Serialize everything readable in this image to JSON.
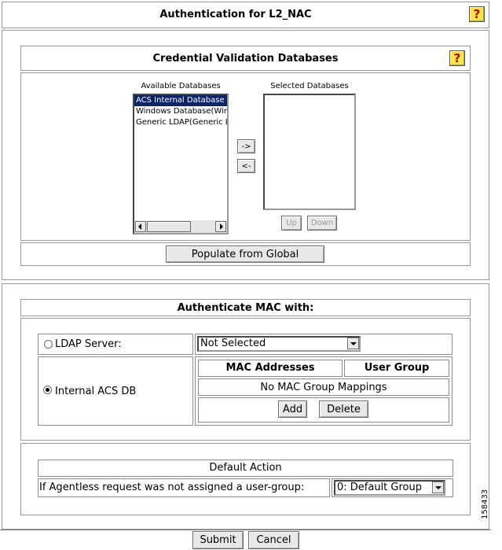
{
  "header": {
    "title": "Authentication for L2_NAC",
    "help_icon": "question-mark-icon"
  },
  "credential": {
    "title": "Credential Validation Databases",
    "available_label": "Available Databases",
    "selected_label": "Selected Databases",
    "available_items": [
      "ACS Internal Database",
      "Windows Database(Windo",
      "Generic LDAP(Generic LL"
    ],
    "selected_items": [],
    "move_right": "->",
    "move_left": "<-",
    "up": "Up",
    "down": "Down",
    "populate": "Populate from Global"
  },
  "mac": {
    "title": "Authenticate MAC with:",
    "ldap_label": "LDAP Server:",
    "ldap_value": "Not Selected",
    "internal_label": "Internal ACS DB",
    "selected_option": "Internal ACS DB",
    "col_mac": "MAC Addresses",
    "col_group": "User Group",
    "empty_text": "No MAC Group Mappings",
    "add": "Add",
    "delete": "Delete"
  },
  "default_action": {
    "title": "Default Action",
    "label": "If Agentless request was not assigned a user-group:",
    "value": "0: Default Group"
  },
  "footer": {
    "submit": "Submit",
    "cancel": "Cancel"
  },
  "side_id": "158433",
  "colors": {
    "selection": "#0a246a",
    "help": "#f7e64a",
    "help_mark": "#c00000"
  }
}
